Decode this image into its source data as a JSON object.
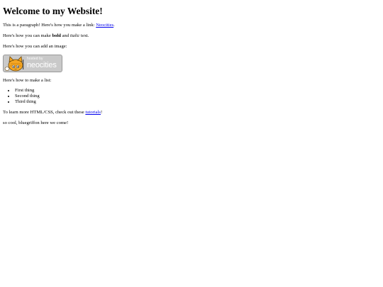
{
  "heading": "Welcome to my Website!",
  "para1": {
    "before": "This is a paragraph! Here's how you make a link: ",
    "link": "Neocities",
    "after": "."
  },
  "para2": {
    "before": "Here's how you can make ",
    "bold": "bold",
    "middle": " and ",
    "italic": "italic",
    "after": " text."
  },
  "para3": "Here's how you can add an image:",
  "badge": {
    "small_text": "hosted by",
    "large_text": "neocities",
    "colors": {
      "background": "#c9c9c9",
      "cat": "#f5a623",
      "border": "#999999"
    }
  },
  "list_intro": "Here's how to make a list:",
  "list_items": [
    "First thing",
    "Second thing",
    "Third thing"
  ],
  "para4": {
    "before": "To learn more HTML/CSS, check out these ",
    "link": "tutorials",
    "after": "!"
  },
  "para5": "so cool, bluegriffon here we come!"
}
